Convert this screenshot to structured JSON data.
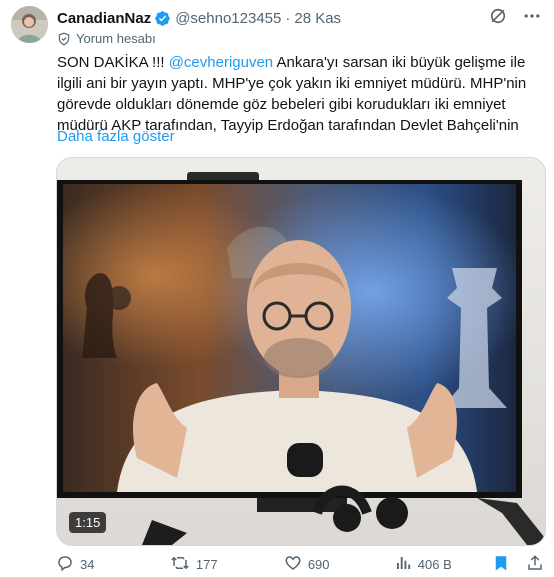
{
  "author": {
    "display_name": "CanadianNaz",
    "handle": "@sehno123455",
    "separator": "·",
    "date": "28 Kas",
    "account_tag": "Yorum hesabı"
  },
  "tweet": {
    "prefix": "SON DAKİKA !!! ",
    "mention": "@cevheriguven",
    "body": " Ankara'yı sarsan iki büyük gelişme ile ilgili ani bir yayın yaptı. MHP'ye çok yakın iki emniyet müdürü. MHP'nin görevde oldukları dönemde göz bebeleri gibi korudukları iki emniyet müdürü AKP tarafından, Tayyip Erdoğan tarafından Devlet Bahçeli'nin",
    "show_more": "Daha fazla göster"
  },
  "media": {
    "duration": "1:15"
  },
  "actions": {
    "replies": "34",
    "reposts": "177",
    "likes": "690",
    "views": "406 B"
  },
  "colors": {
    "accent": "#1d9bf0",
    "secondary_text": "#536471",
    "border": "#cfd9de"
  },
  "icons": [
    "verified-badge-icon",
    "grok-icon",
    "more-icon",
    "shield-icon",
    "reply-icon",
    "repost-icon",
    "like-icon",
    "views-icon",
    "bookmark-icon",
    "share-icon"
  ]
}
